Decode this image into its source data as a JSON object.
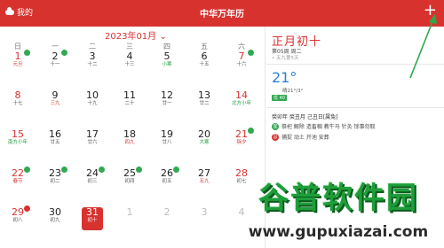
{
  "header": {
    "my_label": "我的",
    "title": "中华万年历",
    "add_icon": "plus-icon"
  },
  "calendar": {
    "month_label": "2023年01月",
    "weekdays": [
      "日",
      "一",
      "二",
      "三",
      "四",
      "五",
      "六"
    ],
    "days": [
      {
        "d": "1",
        "l": "元旦",
        "red": true,
        "lunar_red": true,
        "mark": "g"
      },
      {
        "d": "2",
        "l": "十一",
        "mark": "g"
      },
      {
        "d": "3",
        "l": "十二"
      },
      {
        "d": "4",
        "l": "十三"
      },
      {
        "d": "5",
        "l": "小寒",
        "green": true
      },
      {
        "d": "6",
        "l": "十五"
      },
      {
        "d": "7",
        "l": "十六",
        "red": true,
        "mark": "g"
      },
      {
        "d": "8",
        "l": "十七",
        "red": true
      },
      {
        "d": "9",
        "l": "三九",
        "lunar_red": true
      },
      {
        "d": "10",
        "l": "十九"
      },
      {
        "d": "11",
        "l": "二十"
      },
      {
        "d": "12",
        "l": "廿一"
      },
      {
        "d": "13",
        "l": "廿二"
      },
      {
        "d": "14",
        "l": "北方小年",
        "red": true,
        "green": true
      },
      {
        "d": "15",
        "l": "南方小年",
        "red": true,
        "green": true
      },
      {
        "d": "16",
        "l": "廿五"
      },
      {
        "d": "17",
        "l": "廿六"
      },
      {
        "d": "18",
        "l": "四九",
        "lunar_red": true
      },
      {
        "d": "19",
        "l": "廿八"
      },
      {
        "d": "20",
        "l": "大寒",
        "green": true
      },
      {
        "d": "21",
        "l": "除夕",
        "red": true,
        "lunar_red": true,
        "mark": "g"
      },
      {
        "d": "22",
        "l": "春节",
        "red": true,
        "lunar_red": true,
        "mark": "g"
      },
      {
        "d": "23",
        "l": "初二",
        "mark": "g"
      },
      {
        "d": "24",
        "l": "初三",
        "mark": "g"
      },
      {
        "d": "25",
        "l": "初四",
        "mark": "g"
      },
      {
        "d": "26",
        "l": "初五",
        "mark": "g"
      },
      {
        "d": "27",
        "l": "五九",
        "lunar_red": true
      },
      {
        "d": "28",
        "l": "初七",
        "red": true
      },
      {
        "d": "29",
        "l": "初八",
        "red": true,
        "mark": "r"
      },
      {
        "d": "30",
        "l": "初九"
      },
      {
        "d": "31",
        "l": "初十",
        "today": true
      },
      {
        "d": "1",
        "l": "",
        "gray": true
      },
      {
        "d": "2",
        "l": "",
        "gray": true
      },
      {
        "d": "3",
        "l": "",
        "gray": true
      },
      {
        "d": "4",
        "l": "",
        "gray": true
      }
    ]
  },
  "panel": {
    "lunar_date": "正月初十",
    "week_info": "第05周 周二",
    "jiu_info": "• 五九第5天",
    "temperature": "21°",
    "weather_text": "晴21°/3°",
    "aqi_badge": "优 40",
    "aqi_text": "",
    "ganzhi": "癸卯年 癸丑月 己丑日[属兔]",
    "yi_icon": "宜",
    "yi_text": "祭祀 解除 造畜稠 教牛马 针灸 馀事勿取",
    "ji_icon": "忌",
    "ji_text": "捕捉 动土 开池 安葬"
  },
  "watermark": {
    "text": "谷普软件园",
    "url": "www.gupuxiazai.com"
  },
  "colors": {
    "accent": "#d8322f",
    "green": "#1e9e3a",
    "blue": "#2a7fd9"
  }
}
